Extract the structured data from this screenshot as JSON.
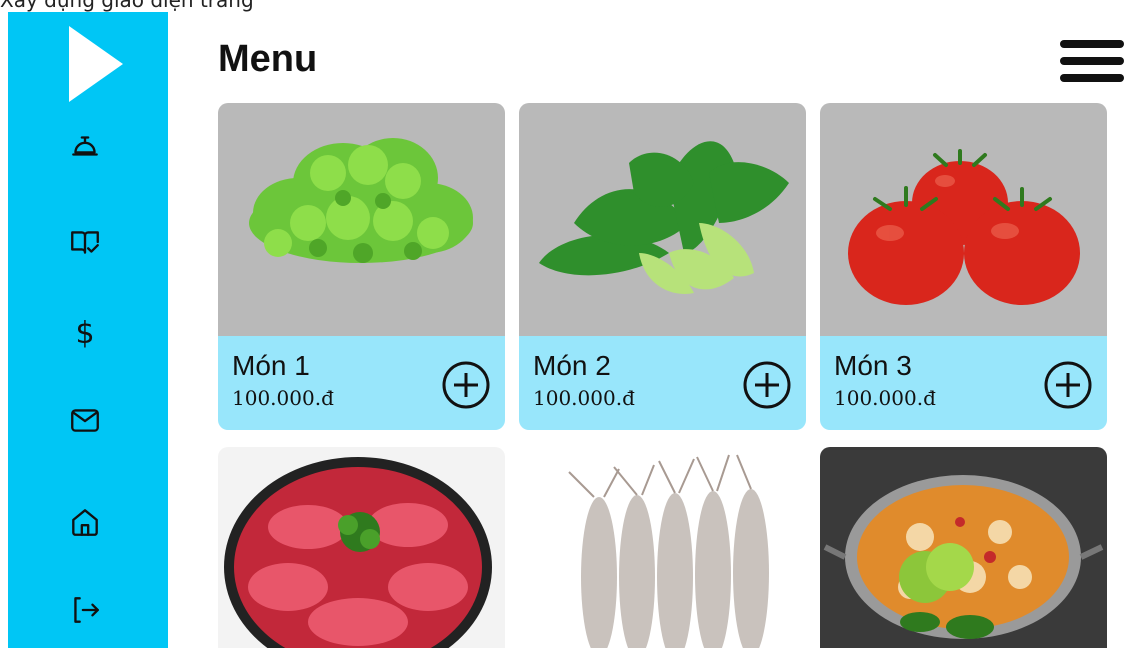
{
  "top_crop_text": "Xây dựng giao diện trang",
  "sidebar": {
    "logo": "play-icon",
    "items": [
      {
        "name": "nav-bell-icon",
        "icon": "bell"
      },
      {
        "name": "nav-menu-book-icon",
        "icon": "book-check"
      },
      {
        "name": "nav-dollar-icon",
        "icon": "dollar",
        "label": "$"
      },
      {
        "name": "nav-mail-icon",
        "icon": "mail"
      },
      {
        "name": "nav-home-icon",
        "icon": "home"
      },
      {
        "name": "nav-logout-icon",
        "icon": "logout"
      }
    ]
  },
  "header": {
    "title": "Menu"
  },
  "menu_items": [
    {
      "name": "Món 1",
      "price": "100.000.đ",
      "image": "lettuce"
    },
    {
      "name": "Món 2",
      "price": "100.000.đ",
      "image": "bok-choy"
    },
    {
      "name": "Món 3",
      "price": "100.000.đ",
      "image": "tomatoes"
    },
    {
      "image": "sliced-beef"
    },
    {
      "image": "shrimp"
    },
    {
      "image": "seafood-hotpot"
    }
  ],
  "colors": {
    "sidebar": "#00c6f5",
    "card_info": "#98e6fb",
    "card_image_bg": "#b9b9b9"
  }
}
